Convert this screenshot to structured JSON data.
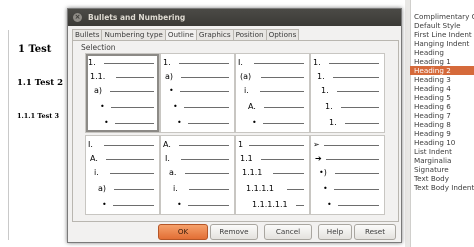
{
  "document": {
    "heading1": "1  Test",
    "heading2": "1.1  Test 2",
    "heading3": "1.1.1   Test 3"
  },
  "styles_panel": {
    "items": [
      {
        "label": "Complimentary Close",
        "selected": false
      },
      {
        "label": "Default Style",
        "selected": false
      },
      {
        "label": "First Line Indent",
        "selected": false
      },
      {
        "label": "Hanging Indent",
        "selected": false
      },
      {
        "label": "Heading",
        "selected": false
      },
      {
        "label": "Heading 1",
        "selected": false
      },
      {
        "label": "Heading 2",
        "selected": true
      },
      {
        "label": "Heading 3",
        "selected": false
      },
      {
        "label": "Heading 4",
        "selected": false
      },
      {
        "label": "Heading 5",
        "selected": false
      },
      {
        "label": "Heading 6",
        "selected": false
      },
      {
        "label": "Heading 7",
        "selected": false
      },
      {
        "label": "Heading 8",
        "selected": false
      },
      {
        "label": "Heading 9",
        "selected": false
      },
      {
        "label": "Heading 10",
        "selected": false
      },
      {
        "label": "List Indent",
        "selected": false
      },
      {
        "label": "Marginalia",
        "selected": false
      },
      {
        "label": "Signature",
        "selected": false
      },
      {
        "label": "Text Body",
        "selected": false
      },
      {
        "label": "Text Body Indent",
        "selected": false
      }
    ],
    "selected_color": "#d56a3b"
  },
  "dialog": {
    "title": "Bullets and Numbering",
    "close_glyph": "×",
    "tabs": [
      {
        "label": "Bullets",
        "active": false
      },
      {
        "label": "Numbering type",
        "active": false
      },
      {
        "label": "Outline",
        "active": true
      },
      {
        "label": "Graphics",
        "active": false
      },
      {
        "label": "Position",
        "active": false
      },
      {
        "label": "Options",
        "active": false
      }
    ],
    "selection_legend": "Selection",
    "outline_options": [
      {
        "selected": true,
        "levels": [
          "1.",
          "1.1.",
          "a)",
          "•",
          "•"
        ]
      },
      {
        "selected": false,
        "levels": [
          "1.",
          "a)",
          "•",
          "•",
          "•"
        ]
      },
      {
        "selected": false,
        "levels": [
          "I.",
          "(a)",
          "i.",
          "A.",
          "•"
        ]
      },
      {
        "selected": false,
        "levels": [
          "1.",
          "1.",
          "1.",
          "1.",
          "1."
        ]
      },
      {
        "selected": false,
        "levels": [
          "I.",
          "A.",
          "i.",
          "a)",
          "•"
        ]
      },
      {
        "selected": false,
        "levels": [
          "A.",
          "I.",
          "a.",
          "i.",
          "•"
        ]
      },
      {
        "selected": false,
        "levels": [
          "1",
          "1.1",
          "1.1.1",
          "1.1.1.1",
          "1.1.1.1.1"
        ]
      },
      {
        "selected": false,
        "levels": [
          "➢",
          "➔",
          "•)",
          "•",
          "•"
        ]
      }
    ],
    "buttons": {
      "ok": "OK",
      "remove": "Remove",
      "cancel": "Cancel",
      "help": "Help",
      "reset": "Reset"
    }
  }
}
